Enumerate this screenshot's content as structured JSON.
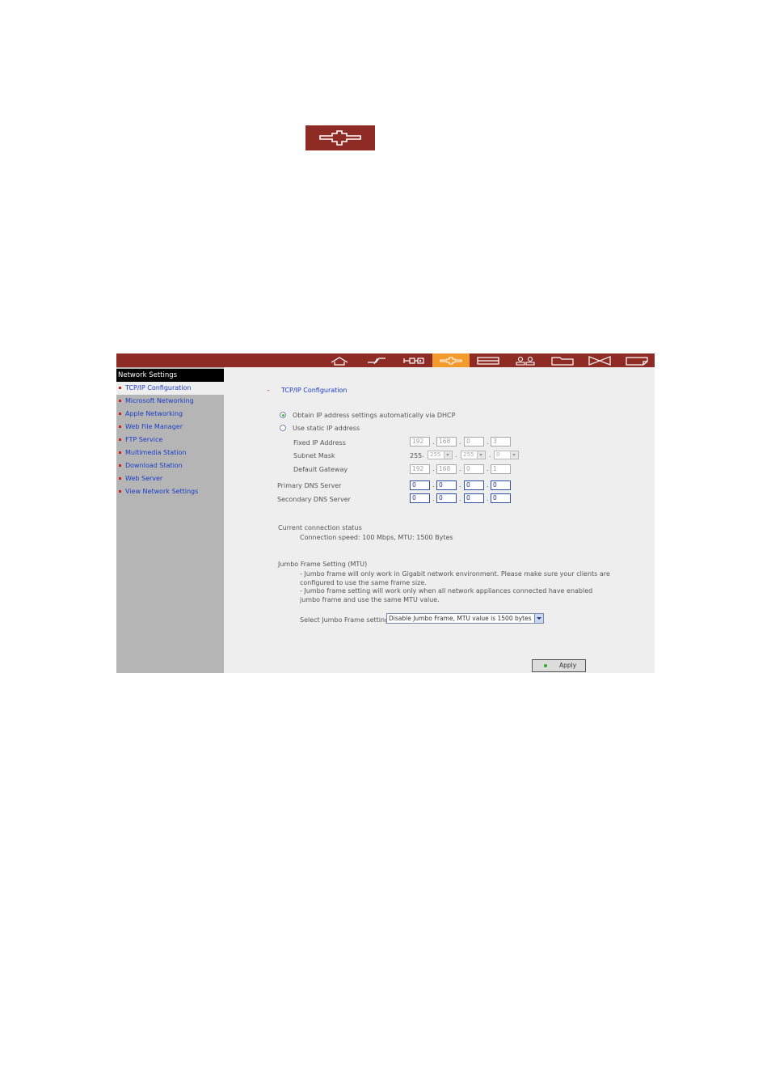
{
  "app": {
    "sidebar": {
      "title": "Network Settings",
      "items": [
        {
          "label": "TCP/IP Configuration"
        },
        {
          "label": "Microsoft Networking"
        },
        {
          "label": "Apple Networking"
        },
        {
          "label": "Web File Manager"
        },
        {
          "label": "FTP Service"
        },
        {
          "label": "Multimedia Station"
        },
        {
          "label": "Download Station"
        },
        {
          "label": "Web Server"
        },
        {
          "label": "View Network Settings"
        }
      ]
    },
    "topnav": {
      "items": [
        "home-icon",
        "quick-config-icon",
        "system-settings-icon",
        "network-settings-icon",
        "device-config-icon",
        "user-management-icon",
        "share-folder-icon",
        "system-tools-icon",
        "logs-statistics-icon"
      ],
      "active": "network-settings-icon"
    },
    "section": {
      "dash": "–",
      "title": "TCP/IP Configuration"
    },
    "ip_mode": {
      "dhcp_label": "Obtain IP address settings automatically via DHCP",
      "static_label": "Use static IP address",
      "selected": "dhcp"
    },
    "fixed_ip": {
      "label": "Fixed IP Address",
      "octets": [
        "192",
        "168",
        "0",
        "3"
      ]
    },
    "subnet": {
      "label": "Subnet Mask",
      "first": "255",
      "octets": [
        "255",
        "255",
        "0"
      ]
    },
    "gateway": {
      "label": "Default Gateway",
      "octets": [
        "192",
        "168",
        "0",
        "1"
      ]
    },
    "primary_dns": {
      "label": "Primary DNS Server",
      "octets": [
        "0",
        "0",
        "0",
        "0"
      ]
    },
    "secondary_dns": {
      "label": "Secondary DNS Server",
      "octets": [
        "0",
        "0",
        "0",
        "0"
      ]
    },
    "status": {
      "heading": "Current connection status",
      "text": "Connection speed: 100 Mbps, MTU: 1500 Bytes"
    },
    "jumbo": {
      "heading": "Jumbo Frame Setting (MTU)",
      "note1_line1": "- Jumbo frame will only work in Gigabit network environment. Please make sure your clients are",
      "note1_line2": "configured to use the same frame size.",
      "note2_line1": "- Jumbo frame setting will work only when all network appliances connected have enabled",
      "note2_line2": "jumbo frame and use the same MTU value.",
      "select_label": "Select Jumbo Frame setting:",
      "select_value": "Disable Jumbo Frame, MTU value is 1500 bytes"
    },
    "apply_label": "Apply"
  },
  "colors": {
    "brand": "#8e2b24",
    "active_tab": "#f39a2c",
    "link": "#1a3cc8",
    "sidebar_bg": "#b5b5b5",
    "content_bg": "#eeeeee"
  }
}
